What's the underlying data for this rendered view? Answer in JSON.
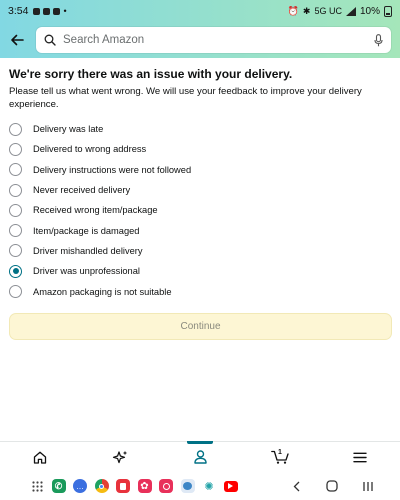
{
  "status_bar": {
    "time": "3:54",
    "network": "5G UC",
    "battery": "10%"
  },
  "search": {
    "placeholder": "Search Amazon"
  },
  "page": {
    "title": "We're sorry there was an issue with your delivery.",
    "subtitle": "Please tell us what went wrong. We will use your feedback to improve your delivery experience."
  },
  "options": [
    {
      "label": "Delivery was late",
      "selected": false
    },
    {
      "label": "Delivered to wrong address",
      "selected": false
    },
    {
      "label": "Delivery instructions were not followed",
      "selected": false
    },
    {
      "label": "Never received delivery",
      "selected": false
    },
    {
      "label": "Received wrong item/package",
      "selected": false
    },
    {
      "label": "Item/package is damaged",
      "selected": false
    },
    {
      "label": "Driver mishandled delivery",
      "selected": false
    },
    {
      "label": "Driver was unprofessional",
      "selected": true
    },
    {
      "label": "Amazon packaging is not suitable",
      "selected": false
    }
  ],
  "continue_label": "Continue",
  "bottom_nav": {
    "items": [
      {
        "icon": "home-icon",
        "active": false
      },
      {
        "icon": "sparkle-icon",
        "active": false
      },
      {
        "icon": "account-icon",
        "active": true
      },
      {
        "icon": "cart-icon",
        "active": false
      },
      {
        "icon": "menu-icon",
        "active": false
      }
    ],
    "cart_count": "1"
  },
  "dock_apps": [
    {
      "icon": "app-grid-icon",
      "color": "#444444"
    },
    {
      "icon": "phone-app-icon",
      "color": "#1a9a5b"
    },
    {
      "icon": "messages-app-icon",
      "color": "#3b6fe0"
    },
    {
      "icon": "chrome-app-icon",
      "color": "#e34133"
    },
    {
      "icon": "red-app-icon",
      "color": "#e8323c"
    },
    {
      "icon": "flower-app-icon",
      "color": "#e8305a"
    },
    {
      "icon": "camera-app-icon",
      "color": "#e8305a"
    },
    {
      "icon": "bear-app-icon",
      "color": "#3d86c6"
    },
    {
      "icon": "pinwheel-app-icon",
      "color": "#23a3a8"
    },
    {
      "icon": "youtube-app-icon",
      "color": "#ff0000"
    }
  ],
  "colors": {
    "accent": "#007185",
    "continue_bg": "#fdf6d4",
    "header_start": "#82d8e3",
    "header_end": "#a5e6ba"
  }
}
